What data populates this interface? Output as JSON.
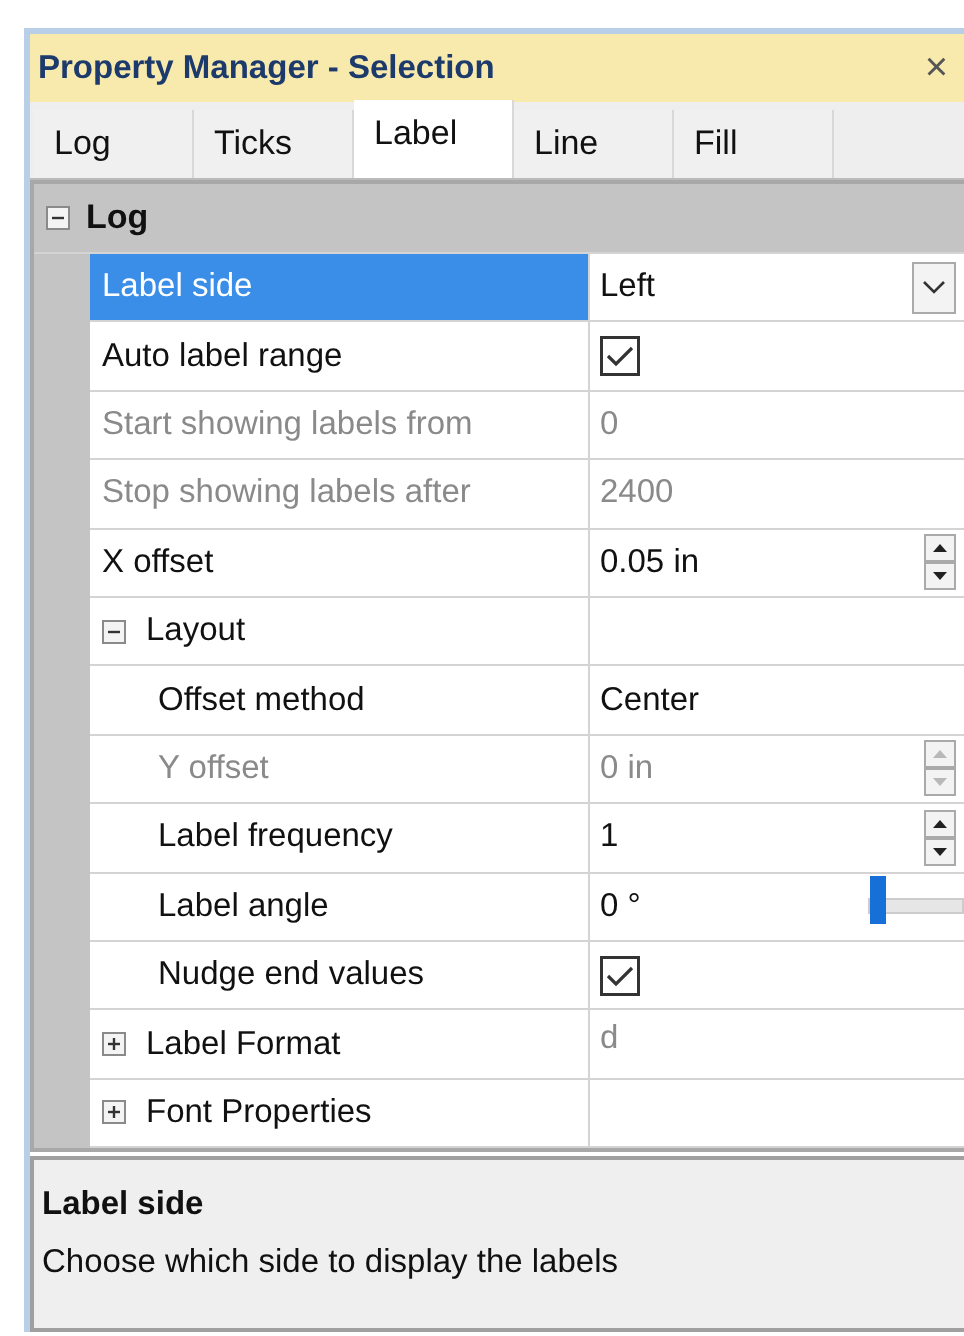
{
  "window": {
    "title": "Property Manager - Selection",
    "close": "×"
  },
  "tabs": [
    {
      "label": "Log",
      "selected": false
    },
    {
      "label": "Ticks",
      "selected": false
    },
    {
      "label": "Label",
      "selected": true
    },
    {
      "label": "Line",
      "selected": false
    },
    {
      "label": "Fill",
      "selected": false
    }
  ],
  "grid": {
    "groups": [
      {
        "label": "Log",
        "expanded": true,
        "children": [
          {
            "kind": "dropdown",
            "label": "Label side",
            "value": "Left",
            "selected": true,
            "disabled": false
          },
          {
            "kind": "checkbox",
            "label": "Auto label range",
            "checked": true,
            "selected": false,
            "disabled": false
          },
          {
            "kind": "text",
            "label": "Start showing labels from",
            "value": "0",
            "selected": false,
            "disabled": true
          },
          {
            "kind": "text",
            "label": "Stop showing labels after",
            "value": "2400",
            "selected": false,
            "disabled": true
          },
          {
            "kind": "spin",
            "label": "X offset",
            "value": "0.05 in",
            "selected": false,
            "disabled": false
          },
          {
            "kind": "group",
            "label": "Layout",
            "expanded": true,
            "selected": false,
            "disabled": false,
            "children": [
              {
                "kind": "text",
                "label": "Offset method",
                "value": "Center",
                "selected": false,
                "disabled": false
              },
              {
                "kind": "spin",
                "label": "Y offset",
                "value": "0 in",
                "selected": false,
                "disabled": true
              },
              {
                "kind": "spin",
                "label": "Label frequency",
                "value": "1",
                "selected": false,
                "disabled": false
              },
              {
                "kind": "slider",
                "label": "Label angle",
                "value": "0 °",
                "level": 0,
                "selected": false,
                "disabled": false
              },
              {
                "kind": "checkbox",
                "label": "Nudge end values",
                "checked": true,
                "selected": false,
                "disabled": false
              }
            ]
          },
          {
            "kind": "group",
            "label": "Label Format",
            "value": "d",
            "expanded": false,
            "selected": false,
            "disabled": false
          },
          {
            "kind": "group",
            "label": "Font Properties",
            "expanded": false,
            "selected": false,
            "disabled": false
          }
        ]
      }
    ]
  },
  "description": {
    "title": "Label side",
    "text": "Choose which side to display the labels"
  }
}
